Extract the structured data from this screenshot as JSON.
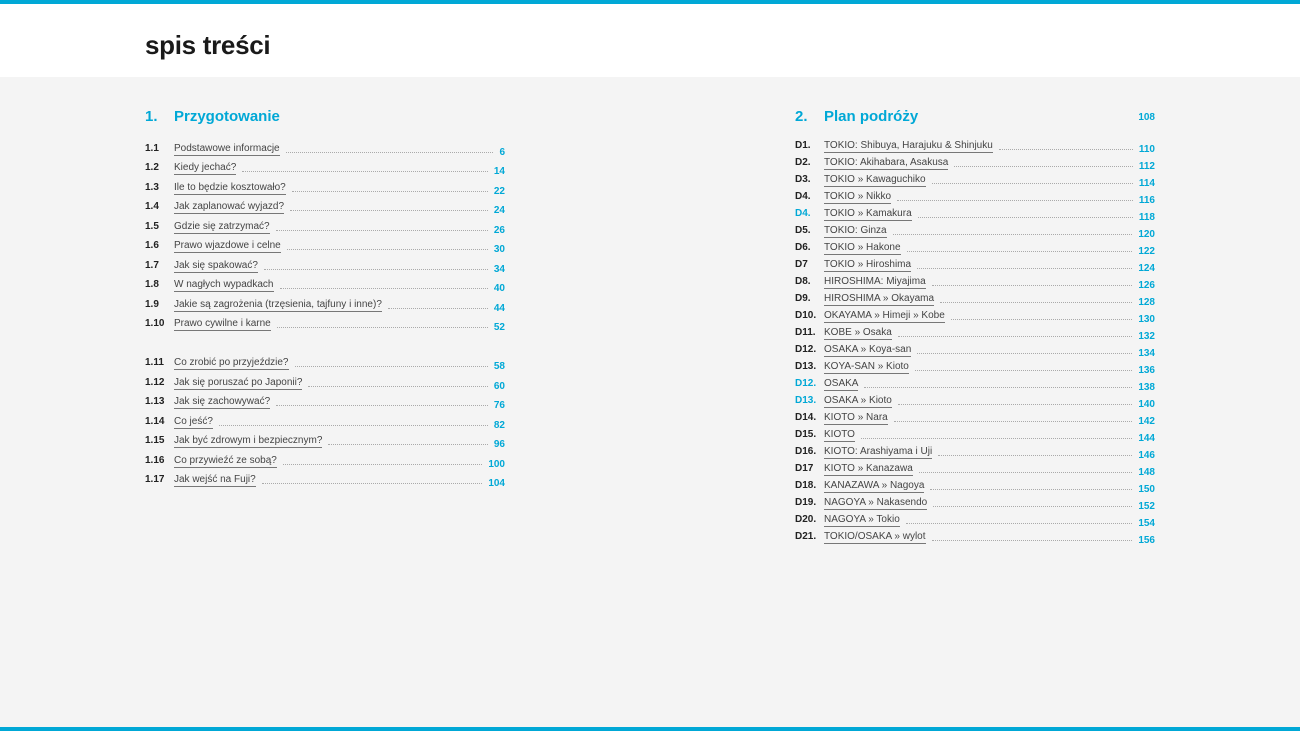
{
  "title": "spis treści",
  "colors": {
    "accent": "#00a8d6",
    "background": "#f4f4f4",
    "header": "#ffffff"
  },
  "section1": {
    "number": "1.",
    "title": "Przygotowanie",
    "items": [
      {
        "num": "1.1",
        "text": "Podstawowe informacje",
        "page": "6"
      },
      {
        "num": "1.2",
        "text": "Kiedy jechać?",
        "page": "14"
      },
      {
        "num": "1.3",
        "text": "Ile to będzie kosztowało?",
        "page": "22"
      },
      {
        "num": "1.4",
        "text": "Jak zaplanować wyjazd?",
        "page": "24"
      },
      {
        "num": "1.5",
        "text": "Gdzie się zatrzymać?",
        "page": "26"
      },
      {
        "num": "1.6",
        "text": "Prawo wjazdowe i celne",
        "page": "30"
      },
      {
        "num": "1.7",
        "text": "Jak się spakować?",
        "page": "34"
      },
      {
        "num": "1.8",
        "text": "W nagłych wypadkach",
        "page": "40"
      },
      {
        "num": "1.9",
        "text": "Jakie są zagrożenia (trzęsienia, tajfuny i inne)?",
        "page": "44"
      },
      {
        "num": "1.10",
        "text": "Prawo cywilne i karne",
        "page": "52"
      },
      {
        "num": "1.11",
        "text": "Co zrobić po przyjeździe?",
        "page": "58"
      },
      {
        "num": "1.12",
        "text": "Jak się poruszać po Japonii?",
        "page": "60"
      },
      {
        "num": "1.13",
        "text": "Jak się zachowywać?",
        "page": "76"
      },
      {
        "num": "1.14",
        "text": "Co jeść?",
        "page": "82"
      },
      {
        "num": "1.15",
        "text": "Jak być zdrowym i bezpiecznym?",
        "page": "96"
      },
      {
        "num": "1.16",
        "text": "Co przywieźć ze sobą?",
        "page": "100"
      },
      {
        "num": "1.17",
        "text": "Jak wejść na Fuji?",
        "page": "104"
      }
    ]
  },
  "section2": {
    "number": "2.",
    "title": "Plan podróży",
    "page": "108",
    "items": [
      {
        "num": "D1.",
        "text": "TOKIO: Shibuya, Harajuku & Shinjuku",
        "page": "110"
      },
      {
        "num": "D2.",
        "text": "TOKIO: Akihabara, Asakusa",
        "page": "112"
      },
      {
        "num": "D3.",
        "text": "TOKIO » Kawaguchiko",
        "page": "114"
      },
      {
        "num": "D4.",
        "text": "TOKIO » Nikko",
        "page": "116"
      },
      {
        "num": "D4.",
        "text": "TOKIO » Kamakura",
        "page": "118"
      },
      {
        "num": "D5.",
        "text": "TOKIO: Ginza",
        "page": "120"
      },
      {
        "num": "D6.",
        "text": "TOKIO » Hakone",
        "page": "122"
      },
      {
        "num": "D7",
        "text": "TOKIO » Hiroshima",
        "page": "124"
      },
      {
        "num": "D8.",
        "text": "HIROSHIMA: Miyajima",
        "page": "126"
      },
      {
        "num": "D9.",
        "text": "HIROSHIMA » Okayama",
        "page": "128"
      },
      {
        "num": "D10.",
        "text": "OKAYAMA » Himeji » Kobe",
        "page": "130"
      },
      {
        "num": "D11.",
        "text": "KOBE » Osaka",
        "page": "132"
      },
      {
        "num": "D12.",
        "text": "OSAKA » Koya-san",
        "page": "134"
      },
      {
        "num": "D13.",
        "text": "KOYA-SAN » Kioto",
        "page": "136"
      },
      {
        "num": "D12.",
        "text": "OSAKA",
        "page": "138"
      },
      {
        "num": "D13.",
        "text": "OSAKA » Kioto",
        "page": "140"
      },
      {
        "num": "D14.",
        "text": "KIOTO » Nara",
        "page": "142"
      },
      {
        "num": "D15.",
        "text": "KIOTO",
        "page": "144"
      },
      {
        "num": "D16.",
        "text": "KIOTO: Arashiyama i Uji",
        "page": "146"
      },
      {
        "num": "D17",
        "text": "KIOTO » Kanazawa",
        "page": "148"
      },
      {
        "num": "D18.",
        "text": "KANAZAWA » Nagoya",
        "page": "150"
      },
      {
        "num": "D19.",
        "text": "NAGOYA » Nakasendo",
        "page": "152"
      },
      {
        "num": "D20.",
        "text": "NAGOYA » Tokio",
        "page": "154"
      },
      {
        "num": "D21.",
        "text": "TOKIO/OSAKA » wylot",
        "page": "156"
      }
    ]
  }
}
